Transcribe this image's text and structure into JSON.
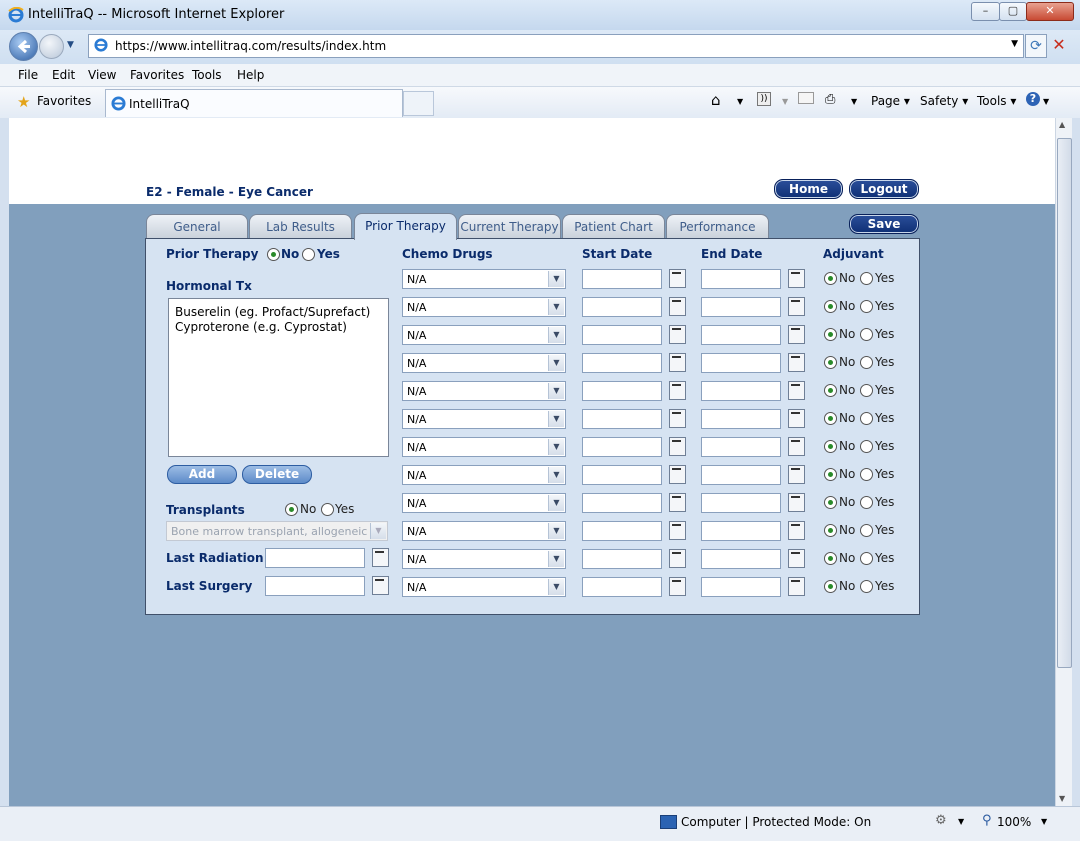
{
  "window": {
    "title": "IntelliTraQ -- Microsoft Internet Explorer"
  },
  "address": {
    "url": "https://www.intellitraq.com/results/index.htm"
  },
  "menu": [
    "File",
    "Edit",
    "View",
    "Favorites",
    "Tools",
    "Help"
  ],
  "favorites": {
    "label": "Favorites",
    "tab_title": "IntelliTraQ"
  },
  "commandbar": {
    "page": "Page",
    "safety": "Safety",
    "tools": "Tools"
  },
  "status": {
    "zone": "Computer | Protected Mode: On",
    "zoom": "100%"
  },
  "app": {
    "patient_title": "E2 - Female - Eye Cancer",
    "home_button": "Home",
    "logout_button": "Logout",
    "save_button": "Save",
    "tabs": [
      "General",
      "Lab Results",
      "Prior Therapy",
      "Current Therapy",
      "Patient Chart",
      "Performance"
    ],
    "active_tab": "Prior Therapy",
    "prior_therapy_label": "Prior Therapy",
    "no": "No",
    "yes": "Yes",
    "hormonal_label": "Hormonal Tx",
    "hormonal_items": [
      "Buserelin (eg. Profact/Suprefact)",
      "Cyproterone (e.g. Cyprostat)"
    ],
    "add_button": "Add",
    "delete_button": "Delete",
    "transplants_label": "Transplants",
    "transplant_select": "Bone marrow transplant, allogeneic",
    "last_radiation_label": "Last Radiation",
    "last_surgery_label": "Last Surgery",
    "col_chemo": "Chemo Drugs",
    "col_start": "Start Date",
    "col_end": "End Date",
    "col_adjuvant": "Adjuvant",
    "chemo_rows": [
      "N/A",
      "N/A",
      "N/A",
      "N/A",
      "N/A",
      "N/A",
      "N/A",
      "N/A",
      "N/A",
      "N/A",
      "N/A",
      "N/A"
    ]
  }
}
